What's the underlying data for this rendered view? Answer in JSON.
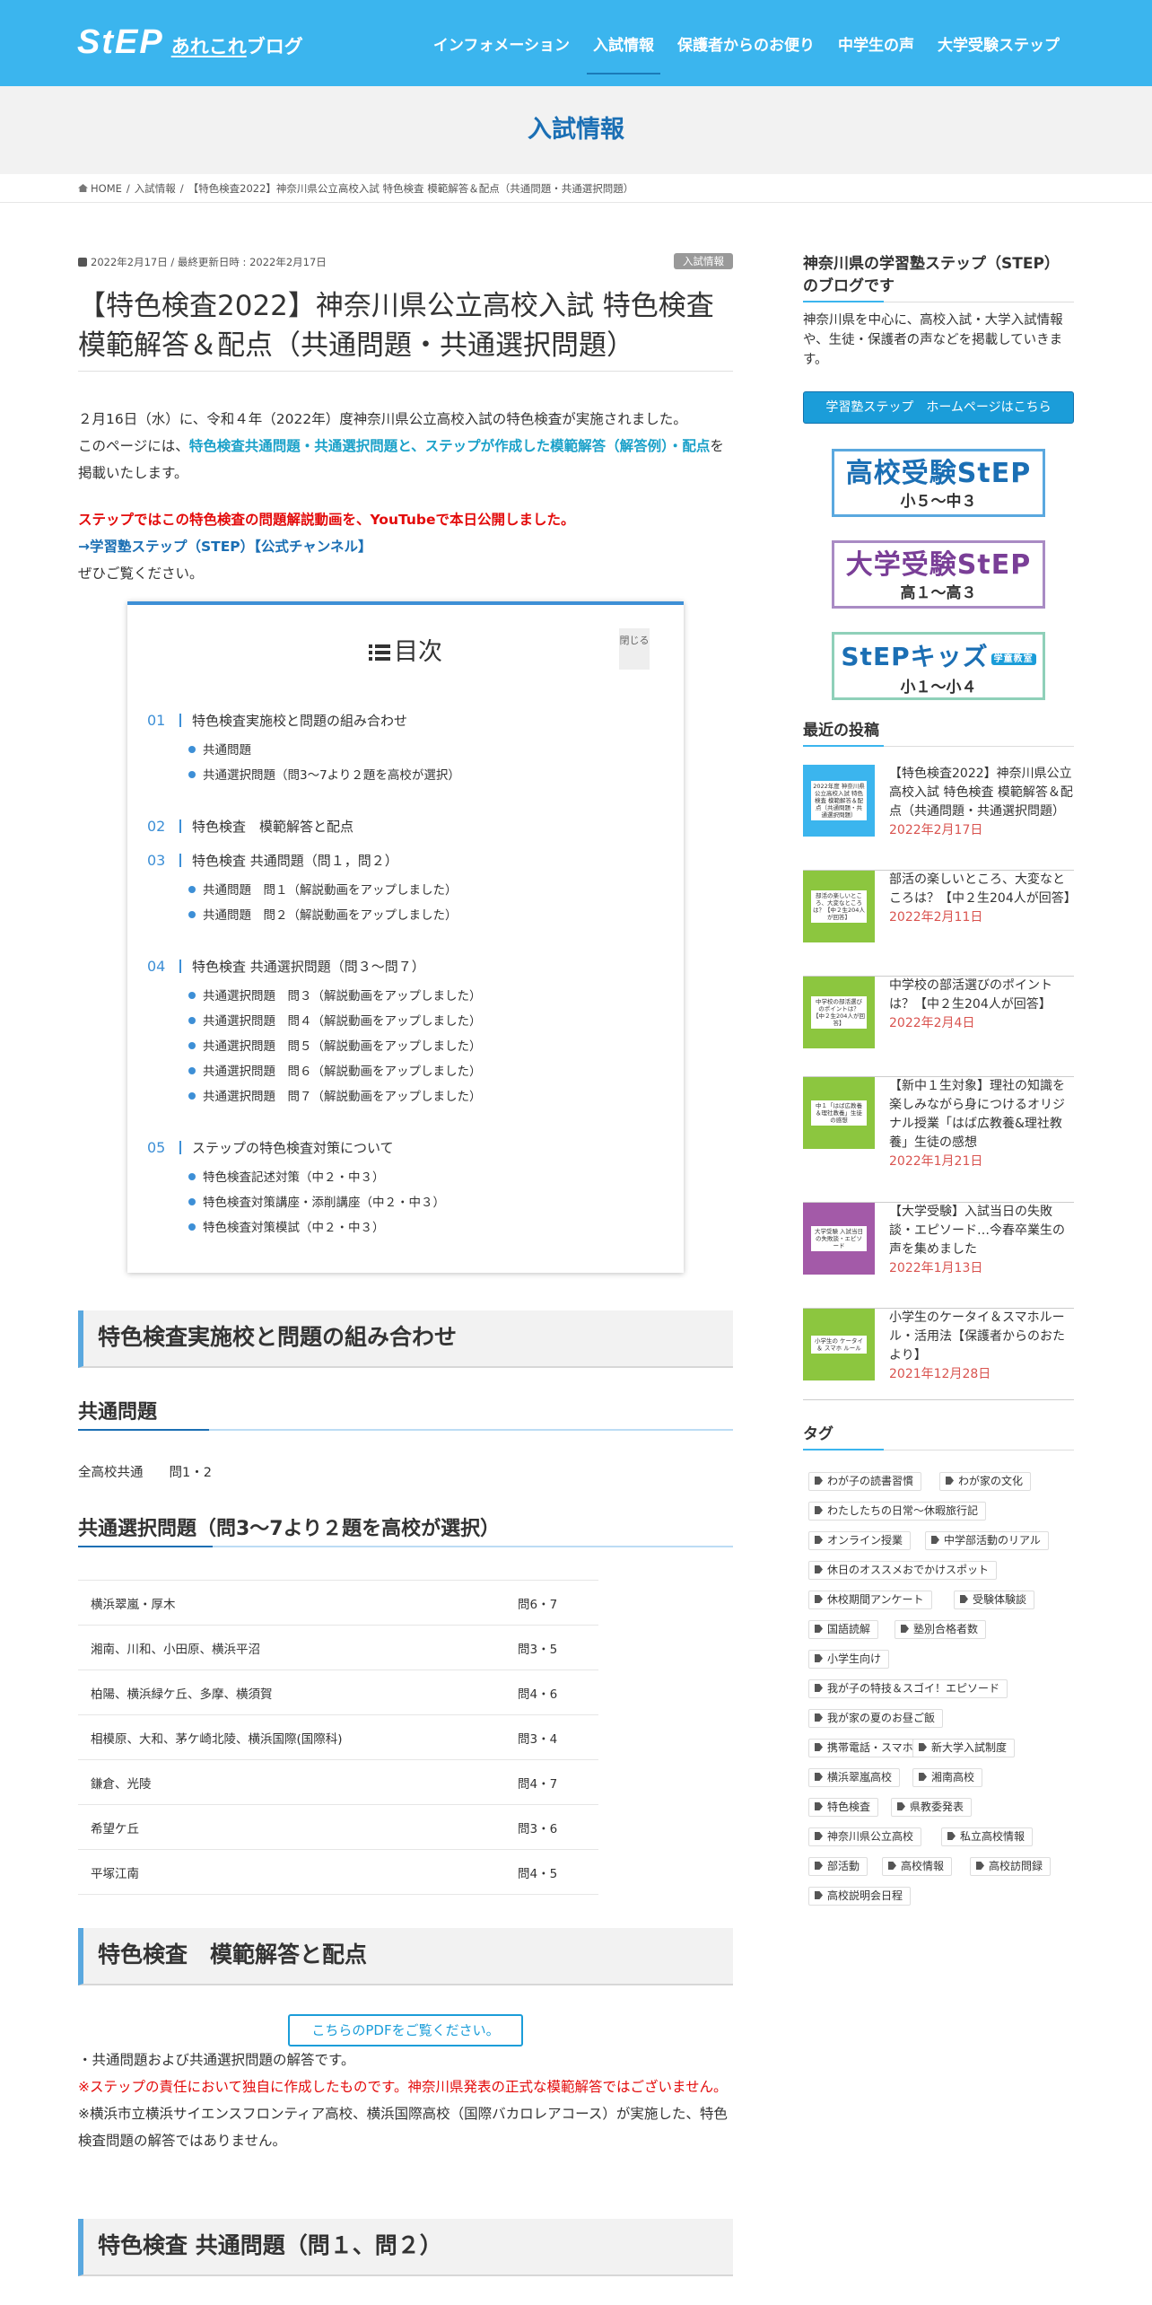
{
  "header": {
    "logo_main": "StEP",
    "logo_sub": "あれこれ",
    "logo_sub2": "ブログ",
    "nav": [
      "インフォメーション",
      "入試情報",
      "保護者からのお便り",
      "中学生の声",
      "大学受験ステップ"
    ],
    "nav_active": 1
  },
  "page_title": "入試情報",
  "breadcrumb": {
    "home": "HOME",
    "cat": "入試情報",
    "current": "【特色検査2022】神奈川県公立高校入試 特色検査 模範解答＆配点（共通問題・共通選択問題）"
  },
  "article": {
    "meta": "2022年2月17日 / 最終更新日時 : 2022年2月17日",
    "category": "入試情報",
    "title": "【特色検査2022】神奈川県公立高校入試 特色検査 模範解答＆配点（共通問題・共通選択問題）",
    "intro1": "２月16日（水）に、令和４年（2022年）度神奈川県公立高校入試の特色検査が実施されました。",
    "intro2_a": "このページには、",
    "intro2_b": "特色検査共通問題・共通選択問題と、ステップが作成した模範解答（解答例）・配点",
    "intro2_c": "を掲載いたします。",
    "video_notice": "ステップではこの特色検査の問題解説動画を、YouTubeで本日公開しました。",
    "channel_link": "→学習塾ステップ（STEP）【公式チャンネル】",
    "please_see": "ぜひご覧ください。"
  },
  "toc": {
    "title": "目次",
    "close": "閉じる",
    "sections": [
      {
        "num": "01",
        "label": "特色検査実施校と問題の組み合わせ",
        "subs": [
          "共通問題",
          "共通選択問題（問3～7より２題を高校が選択）"
        ]
      },
      {
        "num": "02",
        "label": "特色検査　模範解答と配点",
        "subs": []
      },
      {
        "num": "03",
        "label": "特色検査 共通問題（問１，問２）",
        "subs": [
          "共通問題　問１（解説動画をアップしました）",
          "共通問題　問２（解説動画をアップしました）"
        ]
      },
      {
        "num": "04",
        "label": "特色検査 共通選択問題（問３～問７）",
        "subs": [
          "共通選択問題　問３（解説動画をアップしました）",
          "共通選択問題　問４（解説動画をアップしました）",
          "共通選択問題　問５（解説動画をアップしました）",
          "共通選択問題　問６（解説動画をアップしました）",
          "共通選択問題　問７（解説動画をアップしました）"
        ]
      },
      {
        "num": "05",
        "label": "ステップの特色検査対策について",
        "subs": [
          "特色検査記述対策（中２・中３）",
          "特色検査対策講座・添削講座（中２・中３）",
          "特色検査対策模試（中２・中３）"
        ]
      }
    ]
  },
  "sec1": {
    "heading": "特色検査実施校と問題の組み合わせ",
    "common_h": "共通問題",
    "common_text": "全高校共通　　問1・2",
    "select_h": "共通選択問題（問3～7より２題を高校が選択）",
    "rows": [
      {
        "school": "横浜翠嵐・厚木",
        "q": "問6・7"
      },
      {
        "school": "湘南、川和、小田原、横浜平沼",
        "q": "問3・5"
      },
      {
        "school": "柏陽、横浜緑ケ丘、多摩、横須賀",
        "q": "問4・6"
      },
      {
        "school": "相模原、大和、茅ケ崎北陵、横浜国際(国際科)",
        "q": "問3・4"
      },
      {
        "school": "鎌倉、光陵",
        "q": "問4・7"
      },
      {
        "school": "希望ケ丘",
        "q": "問3・6"
      },
      {
        "school": "平塚江南",
        "q": "問4・5"
      }
    ]
  },
  "sec2": {
    "heading": "特色検査　模範解答と配点",
    "pdf_button": "こちらのPDFをご覧ください。",
    "note1": "・共通問題および共通選択問題の解答です。",
    "note2": "※ステップの責任において独自に作成したものです。神奈川県発表の正式な模範解答ではございません。",
    "note3": "※横浜市立横浜サイエンスフロンティア高校、横浜国際高校（国際バカロレアコース）が実施した、特色検査問題の解答ではありません。"
  },
  "sec3": {
    "heading": "特色検査 共通問題（問１、問２）"
  },
  "sidebar": {
    "about_h": "神奈川県の学習塾ステップ（STEP）のブログです",
    "about_text": "神奈川県を中心に、高校入試・大学入試情報や、生徒・保護者の声などを掲載していきます。",
    "home_btn": "学習塾ステップ　ホームページはこちら",
    "banners": [
      {
        "main": "高校受験StEP",
        "sub": "小５〜中３",
        "color": "#1b6fb4"
      },
      {
        "main": "大学受験StEP",
        "sub": "高１〜高３",
        "color": "#7a3f97"
      },
      {
        "main": "StEPキッズ",
        "sub": "小１〜小４",
        "color": "#1b6fb4",
        "badge": "学童教室"
      }
    ],
    "recent_h": "最近の投稿",
    "posts": [
      {
        "title": "【特色検査2022】神奈川県公立高校入試 特色検査 模範解答＆配点（共通問題・共通選択問題）",
        "date": "2022年2月17日",
        "thumb_color": "#3bb5ee",
        "thumb_text": "2022年度 神奈川県公立高校入試 特色検査 模範解答＆配点（共通問題・共通選択問題）"
      },
      {
        "title": "部活の楽しいところ、大変なところは？【中２生204人が回答】",
        "date": "2022年2月11日",
        "thumb_color": "#8cc63f",
        "thumb_text": "部活の楽しいところ、大変なところは？【中２生204人が回答】"
      },
      {
        "title": "中学校の部活選びのポイントは？【中２生204人が回答】",
        "date": "2022年2月4日",
        "thumb_color": "#8cc63f",
        "thumb_text": "中学校の部活選びのポイントは？【中２生204人が回答】"
      },
      {
        "title": "【新中１生対象】理社の知識を楽しみながら身につけるオリジナル授業「はば広教養&理社教養」生徒の感想",
        "date": "2022年1月21日",
        "thumb_color": "#8cc63f",
        "thumb_text": "中１「はば広教養＆理社教養」生徒の感想"
      },
      {
        "title": "【大学受験】入試当日の失敗談・エピソード…今春卒業生の声を集めました",
        "date": "2022年1月13日",
        "thumb_color": "#a35aa8",
        "thumb_text": "大学受験 入試当日の失敗談・エピソード"
      },
      {
        "title": "小学生のケータイ＆スマホルール・活用法【保護者からのおたより】",
        "date": "2021年12月28日",
        "thumb_color": "#8cc63f",
        "thumb_text": "小学生の ケータイ＆ スマホ ルール"
      }
    ],
    "tags_h": "タグ",
    "tags": [
      "わが子の読書習慣",
      "わが家の文化",
      "わたしたちの日常～休暇旅行記",
      "オンライン授業",
      "中学部活動のリアル",
      "休日のオススメおでかけスポット",
      "休校期間アンケート",
      "受験体験談",
      "国語読解",
      "塾別合格者数",
      "小学生向け",
      "我が子の特技＆スゴイ！エピソード",
      "我が家の夏のお昼ご飯",
      "携帯電話・スマホ",
      "新大学入試制度",
      "横浜翠嵐高校",
      "湘南高校",
      "特色検査",
      "県教委発表",
      "神奈川県公立高校",
      "私立高校情報",
      "部活動",
      "高校情報",
      "高校訪問録",
      "高校説明会日程"
    ]
  }
}
